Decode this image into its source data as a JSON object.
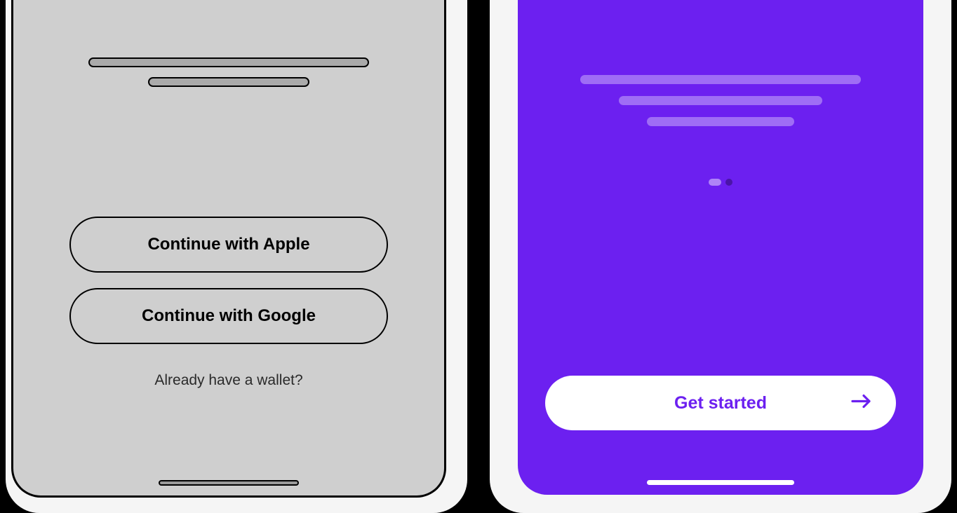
{
  "left_screen": {
    "auth": {
      "apple_label": "Continue with Apple",
      "google_label": "Continue with Google"
    },
    "wallet_link": "Already have a wallet?"
  },
  "right_screen": {
    "cta_label": "Get started",
    "accent_color": "#6c20f0"
  }
}
